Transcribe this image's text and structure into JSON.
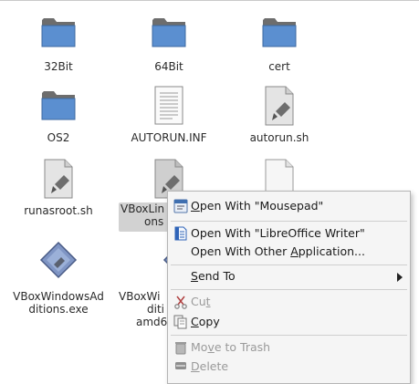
{
  "files": [
    {
      "name": "32Bit",
      "icon": "folder-icon"
    },
    {
      "name": "64Bit",
      "icon": "folder-icon"
    },
    {
      "name": "cert",
      "icon": "folder-icon"
    },
    {
      "name": "OS2",
      "icon": "folder-icon"
    },
    {
      "name": "AUTORUN.INF",
      "icon": "text-document-icon"
    },
    {
      "name": "autorun.sh",
      "icon": "script-icon"
    },
    {
      "name": "runasroot.sh",
      "icon": "script-icon"
    },
    {
      "name_line1": "VBoxLin",
      "name_line2": "ons",
      "icon": "script-icon",
      "selected": true
    },
    {
      "name": "",
      "icon": "blank-document-icon"
    },
    {
      "name_line1": "VBoxWindowsAd",
      "name_line2": "ditions.exe",
      "icon": "executable-icon"
    },
    {
      "name_line1": "VBoxWi",
      "name_line2": "diti",
      "name_line3": "amd6",
      "icon": "executable-icon"
    }
  ],
  "context_menu": {
    "open_mousepad": {
      "pre": "",
      "mnemonic": "O",
      "post": "pen With \"Mousepad\"",
      "icon": "mousepad-icon"
    },
    "open_libreoffice": {
      "pre": "Open With \"LibreOffice Writer\"",
      "icon": "libreoffice-writer-icon"
    },
    "open_other": {
      "pre": "Open With Other ",
      "mnemonic": "A",
      "post": "pplication..."
    },
    "send_to": {
      "pre": "",
      "mnemonic": "S",
      "post": "end To",
      "icon": "submenu-arrow-icon"
    },
    "cut": {
      "pre": "Cu",
      "mnemonic": "t",
      "post": "",
      "icon": "scissors-icon"
    },
    "copy": {
      "pre": "",
      "mnemonic": "C",
      "post": "opy",
      "icon": "copy-icon"
    },
    "move_to_trash": {
      "pre": "Mo",
      "mnemonic": "v",
      "post": "e to Trash",
      "icon": "trash-icon"
    },
    "delete": {
      "pre": "",
      "mnemonic": "D",
      "post": "elete",
      "icon": "delete-icon"
    }
  },
  "colors": {
    "folder": "#5b8fd0",
    "folder_dark": "#4a73a6",
    "selection": "#d2d2d2",
    "menu_bg": "#f5f5f5",
    "disabled_text": "#9a9a9a"
  }
}
